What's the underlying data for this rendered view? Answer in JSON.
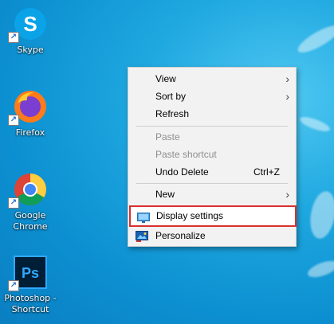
{
  "desktop": {
    "icons": [
      {
        "label": "Skype",
        "icon": "skype-icon"
      },
      {
        "label": "Firefox",
        "icon": "firefox-icon"
      },
      {
        "label": "Google Chrome",
        "icon": "chrome-icon"
      },
      {
        "label": "Photoshop - Shortcut",
        "icon": "photoshop-icon",
        "badge": "Ps"
      }
    ]
  },
  "context_menu": {
    "items": [
      {
        "label": "View",
        "submenu": true
      },
      {
        "label": "Sort by",
        "submenu": true
      },
      {
        "label": "Refresh"
      },
      {
        "label": "Paste",
        "disabled": true
      },
      {
        "label": "Paste shortcut",
        "disabled": true
      },
      {
        "label": "Undo Delete",
        "shortcut": "Ctrl+Z"
      },
      {
        "label": "New",
        "submenu": true
      },
      {
        "label": "Display settings",
        "icon": "display-icon",
        "highlighted": true
      },
      {
        "label": "Personalize",
        "icon": "personalize-icon"
      }
    ]
  },
  "colors": {
    "highlight_border": "#d9302f",
    "desktop_blue": "#1fa8e0"
  }
}
